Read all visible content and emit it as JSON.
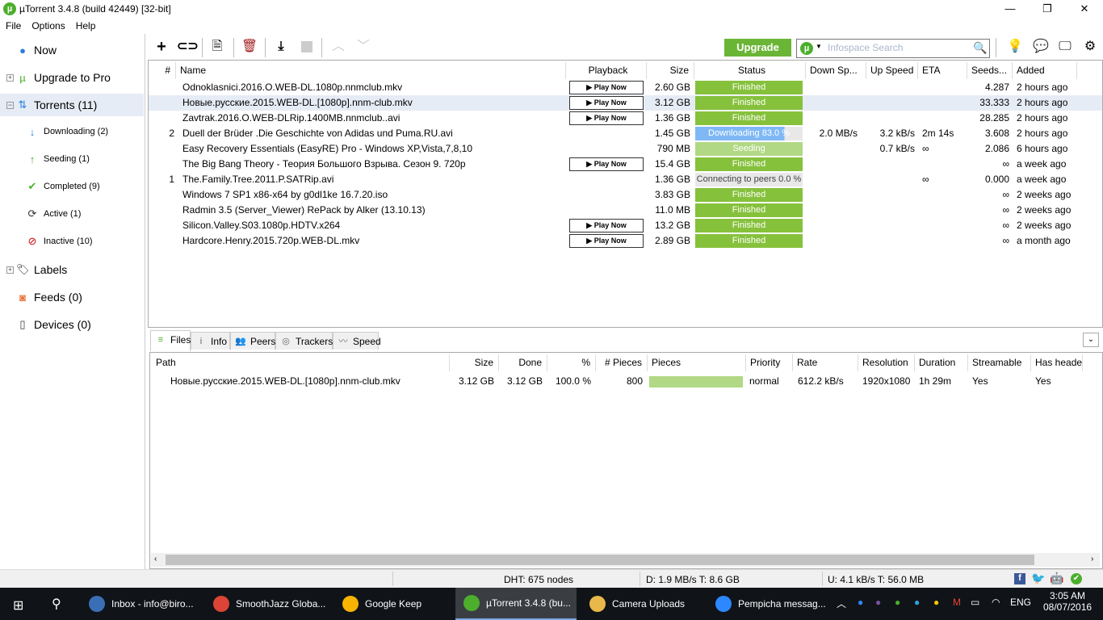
{
  "window": {
    "title": "µTorrent 3.4.8  (build 42449) [32-bit]",
    "logo": "µ",
    "min": "—",
    "max": "❐",
    "close": "✕"
  },
  "menu": [
    "File",
    "Options",
    "Help"
  ],
  "sidebar": [
    {
      "label": "Now",
      "icon": "now-icon",
      "glyph": "●",
      "color": "#2a7de1",
      "sub": false
    },
    {
      "label": "Upgrade to Pro",
      "icon": "utorrent-icon",
      "glyph": "µ",
      "color": "#4cae2c",
      "sub": false,
      "expander": "+"
    },
    {
      "label": "Torrents (11)",
      "icon": "torrents-icon",
      "glyph": "⇅",
      "color": "#2a7de1",
      "sub": false,
      "expander": "−",
      "selected": true
    },
    {
      "label": "Downloading (2)",
      "icon": "download-arrow-icon",
      "glyph": "↓",
      "color": "#2a7de1",
      "sub": true
    },
    {
      "label": "Seeding (1)",
      "icon": "upload-arrow-icon",
      "glyph": "↑",
      "color": "#4cae2c",
      "sub": true
    },
    {
      "label": "Completed (9)",
      "icon": "checkmark-icon",
      "glyph": "✔",
      "color": "#4cae2c",
      "sub": true
    },
    {
      "label": "Active (1)",
      "icon": "refresh-icon",
      "glyph": "⟳",
      "color": "#333",
      "sub": true
    },
    {
      "label": "Inactive (10)",
      "icon": "inactive-icon",
      "glyph": "⊘",
      "color": "#c00",
      "sub": true
    },
    {
      "label": "Labels",
      "icon": "tag-icon",
      "glyph": "🏷",
      "color": "#333",
      "sub": false,
      "expander": "+"
    },
    {
      "label": "Feeds (0)",
      "icon": "rss-icon",
      "glyph": "◙",
      "color": "#e8743b",
      "sub": false
    },
    {
      "label": "Devices (0)",
      "icon": "device-icon",
      "glyph": "▯",
      "color": "#333",
      "sub": false
    }
  ],
  "toolbar": {
    "upgrade": "Upgrade",
    "search_placeholder": "Infospace Search"
  },
  "columns": [
    "#",
    "Name",
    "Playback",
    "Size",
    "Status",
    "Down Sp...",
    "Up Speed",
    "ETA",
    "Seeds...",
    "Added"
  ],
  "play_label": "▶ Play Now",
  "torrents": [
    {
      "num": "",
      "name": "Odnoklasnici.2016.O.WEB-DL.1080p.nnmclub.mkv",
      "play": true,
      "size": "2.60 GB",
      "status": "Finished",
      "kind": "finished",
      "progress": 100,
      "down": "",
      "up": "",
      "eta": "",
      "seeds": "4.287",
      "added": "2 hours ago"
    },
    {
      "num": "",
      "name": "Новые.русские.2015.WEB-DL.[1080p].nnm-club.mkv",
      "play": true,
      "size": "3.12 GB",
      "status": "Finished",
      "kind": "finished",
      "progress": 100,
      "down": "",
      "up": "",
      "eta": "",
      "seeds": "33.333",
      "added": "2 hours ago",
      "selected": true
    },
    {
      "num": "",
      "name": "Zavtrak.2016.O.WEB-DLRip.1400MB.nnmclub..avi",
      "play": true,
      "size": "1.36 GB",
      "status": "Finished",
      "kind": "finished",
      "progress": 100,
      "down": "",
      "up": "",
      "eta": "",
      "seeds": "28.285",
      "added": "2 hours ago"
    },
    {
      "num": "2",
      "name": "Duell der Brüder .Die Geschichte von Adidas und Puma.RU.avi",
      "play": false,
      "size": "1.45 GB",
      "status": "Downloading 83.0 %",
      "kind": "downloading",
      "progress": 83,
      "down": "2.0 MB/s",
      "up": "3.2 kB/s",
      "eta": "2m 14s",
      "seeds": "3.608",
      "added": "2 hours ago"
    },
    {
      "num": "",
      "name": "Easy Recovery Essentials (EasyRE) Pro - Windows XP,Vista,7,8,10",
      "play": false,
      "size": "790 MB",
      "status": "Seeding",
      "kind": "seeding",
      "progress": 100,
      "down": "",
      "up": "0.7 kB/s",
      "eta": "∞",
      "seeds": "2.086",
      "added": "6 hours ago"
    },
    {
      "num": "",
      "name": "The Big Bang Theory - Теория Большого Взрыва. Сезон 9. 720p",
      "play": true,
      "size": "15.4 GB",
      "status": "Finished",
      "kind": "finished",
      "progress": 100,
      "down": "",
      "up": "",
      "eta": "",
      "seeds": "∞",
      "added": "a week ago"
    },
    {
      "num": "1",
      "name": "The.Family.Tree.2011.P.SATRip.avi",
      "play": false,
      "size": "1.36 GB",
      "status": "Connecting to peers 0.0 %",
      "kind": "connecting",
      "progress": 0,
      "down": "",
      "up": "",
      "eta": "∞",
      "seeds": "0.000",
      "added": "a week ago"
    },
    {
      "num": "",
      "name": "Windows 7 SP1 x86-x64 by g0dl1ke 16.7.20.iso",
      "play": false,
      "size": "3.83 GB",
      "status": "Finished",
      "kind": "finished",
      "progress": 100,
      "down": "",
      "up": "",
      "eta": "",
      "seeds": "∞",
      "added": "2 weeks ago"
    },
    {
      "num": "",
      "name": "Radmin 3.5 (Server_Viewer) RePack by Alker (13.10.13)",
      "play": false,
      "size": "11.0 MB",
      "status": "Finished",
      "kind": "finished",
      "progress": 100,
      "down": "",
      "up": "",
      "eta": "",
      "seeds": "∞",
      "added": "2 weeks ago"
    },
    {
      "num": "",
      "name": "Silicon.Valley.S03.1080p.HDTV.x264",
      "play": true,
      "size": "13.2 GB",
      "status": "Finished",
      "kind": "finished",
      "progress": 100,
      "down": "",
      "up": "",
      "eta": "",
      "seeds": "∞",
      "added": "2 weeks ago"
    },
    {
      "num": "",
      "name": "Hardcore.Henry.2015.720p.WEB-DL.mkv",
      "play": true,
      "size": "2.89 GB",
      "status": "Finished",
      "kind": "finished",
      "progress": 100,
      "down": "",
      "up": "",
      "eta": "",
      "seeds": "∞",
      "added": "a month ago"
    }
  ],
  "colors": {
    "finished": "#86c13c",
    "seeding": "#b1d885",
    "downloading": "#7fb8f5",
    "track": "#e8e8e8",
    "accent": "#6bb536"
  },
  "tabs": [
    "Files",
    "Info",
    "Peers",
    "Trackers",
    "Speed"
  ],
  "file_columns": [
    "Path",
    "Size",
    "Done",
    "%",
    "# Pieces",
    "Pieces",
    "Priority",
    "Rate",
    "Resolution",
    "Duration",
    "Streamable",
    "Has header"
  ],
  "files": [
    {
      "path": "Новые.русские.2015.WEB-DL.[1080p].nnm-club.mkv",
      "size": "3.12 GB",
      "done": "3.12 GB",
      "pct": "100.0 %",
      "pieces": "800",
      "pieces_progress": 100,
      "priority": "normal",
      "rate": "612.2 kB/s",
      "resolution": "1920x1080",
      "duration": "1h 29m",
      "streamable": "Yes",
      "has_header": "Yes"
    }
  ],
  "statusbar": {
    "dht": "DHT: 675 nodes",
    "down": "D: 1.9 MB/s T: 8.6 GB",
    "up": "U: 4.1 kB/s T: 56.0 MB"
  },
  "taskbar": {
    "apps": [
      {
        "label": "Inbox - info@biro...",
        "icon": "thunderbird-icon",
        "color": "#3a6fb5"
      },
      {
        "label": "SmoothJazz Globa...",
        "icon": "chrome-icon",
        "color": "#db4437"
      },
      {
        "label": "Google Keep",
        "icon": "keep-icon",
        "color": "#f6b400"
      },
      {
        "label": "µTorrent 3.4.8  (bu...",
        "icon": "utorrent-icon",
        "color": "#4cae2c",
        "active": true
      },
      {
        "label": "Camera Uploads",
        "icon": "folder-icon",
        "color": "#e8b84a"
      },
      {
        "label": "Pempicha messag...",
        "icon": "messenger-icon",
        "color": "#2d88ff"
      }
    ],
    "lang": "ENG",
    "time": "3:05 AM",
    "date": "08/07/2016"
  }
}
